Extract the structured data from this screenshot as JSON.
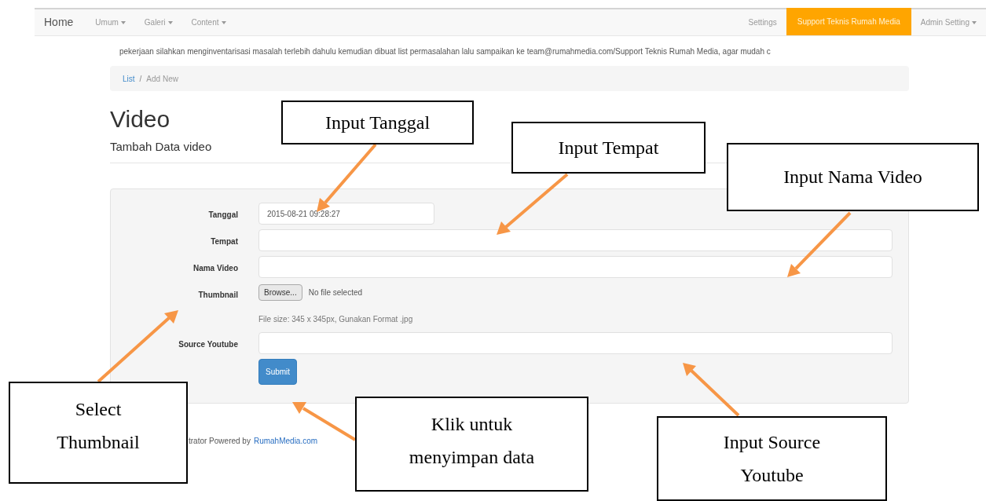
{
  "navbar": {
    "brand": "Home",
    "left_menus": [
      {
        "label": "Umum",
        "dropdown": true
      },
      {
        "label": "Galeri",
        "dropdown": true
      },
      {
        "label": "Content",
        "dropdown": true
      }
    ],
    "right_menus": [
      {
        "label": "Settings",
        "dropdown": false,
        "highlighted": false
      },
      {
        "label": "Support Teknis Rumah Media",
        "dropdown": false,
        "highlighted": true
      },
      {
        "label": "Admin Setting",
        "dropdown": true,
        "highlighted": false
      }
    ]
  },
  "notice": "pekerjaan silahkan menginventarisasi masalah terlebih dahulu kemudian dibuat list permasalahan lalu sampaikan ke team@rumahmedia.com/Support Teknis Rumah Media, agar mudah c",
  "breadcrumb": {
    "separator": "/",
    "items": [
      {
        "label": "List",
        "kind": "link"
      },
      {
        "label": "Add New",
        "kind": "current"
      }
    ]
  },
  "page_title": "Video",
  "subtitle": "Tambah Data video",
  "form": {
    "fields": [
      {
        "label": "Tanggal",
        "kind": "date",
        "value": "2015-08-21 09:28:27"
      },
      {
        "label": "Tempat",
        "kind": "text"
      },
      {
        "label": "Nama Video",
        "kind": "text"
      },
      {
        "label": "Thumbnail",
        "kind": "file",
        "button": "Browse...",
        "status": "No file selected",
        "help": "File size: 345 x 345px, Gunakan Format .jpg"
      },
      {
        "label": "Source Youtube",
        "kind": "text"
      }
    ],
    "submit": "Submit"
  },
  "footer": {
    "text": "trator Powered by",
    "link": "RumahMedia.com"
  },
  "callouts": [
    {
      "text": "Input Tanggal"
    },
    {
      "text": "Input Tempat"
    },
    {
      "text": "Input Nama Video"
    },
    {
      "text": "Select Thumbnail"
    },
    {
      "text": "Klik untuk menyimpan data"
    },
    {
      "text": "Input Source Youtube"
    }
  ]
}
